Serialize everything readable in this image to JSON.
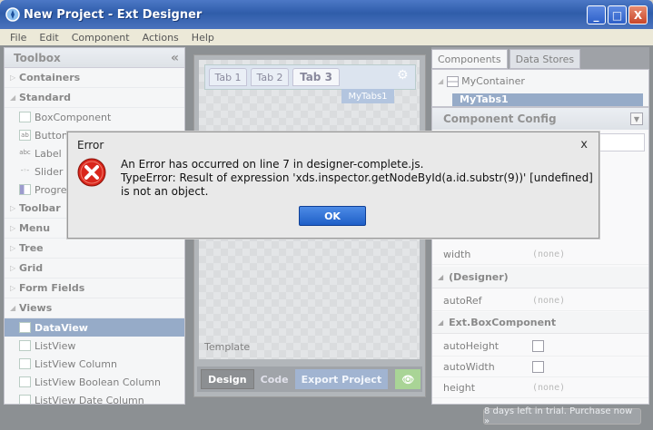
{
  "window": {
    "title": "New Project - Ext Designer",
    "minimize": "_",
    "maximize": "□",
    "close": "X"
  },
  "menu": [
    "File",
    "Edit",
    "Component",
    "Actions",
    "Help"
  ],
  "toolbox": {
    "title": "Toolbox",
    "collapse": "«",
    "containers": "Containers",
    "standard": "Standard",
    "standard_items": [
      "BoxComponent",
      "Button",
      "Label",
      "Slider",
      "ProgressBar"
    ],
    "toolbar": "Toolbar",
    "menu": "Menu",
    "tree": "Tree",
    "grid": "Grid",
    "form_fields": "Form Fields",
    "views": "Views",
    "view_items": [
      "DataView",
      "ListView",
      "ListView Column",
      "ListView Boolean Column",
      "ListView Date Column"
    ]
  },
  "canvas": {
    "tabs": [
      "Tab 1",
      "Tab 2",
      "Tab 3"
    ],
    "mytabs_label": "MyTabs1",
    "template_label": "Template",
    "bottom_buttons": {
      "design": "Design",
      "code": "Code",
      "export": "Export Project"
    }
  },
  "right": {
    "tabs": [
      "Components",
      "Data Stores"
    ],
    "tree_root": "MyContainer",
    "tree_child": "MyTabs1",
    "config_title": "Component Config",
    "props": [
      {
        "key": "width",
        "value": "(none)"
      },
      {
        "key": "autoRef",
        "value": "(none)"
      },
      {
        "key": "autoHeight",
        "value": ""
      },
      {
        "key": "autoWidth",
        "value": ""
      },
      {
        "key": "height",
        "value": "(none)"
      }
    ],
    "sections": [
      "(Designer)",
      "Ext.BoxComponent"
    ]
  },
  "status": {
    "trial": "8 days left in trial. Purchase now »"
  },
  "dialog": {
    "title": "Error",
    "close": "x",
    "line1": "An Error has occurred on line 7 in designer-complete.js.",
    "line2": "TypeError: Result of expression 'xds.inspector.getNodeById(a.id.substr(9))' [undefined] is not an object.",
    "ok": "OK"
  },
  "colors": {
    "titlebar": "#2f5daa",
    "selection": "#4a6ea0",
    "ok_button": "#1f5fc7",
    "error_icon": "#d9261c"
  }
}
